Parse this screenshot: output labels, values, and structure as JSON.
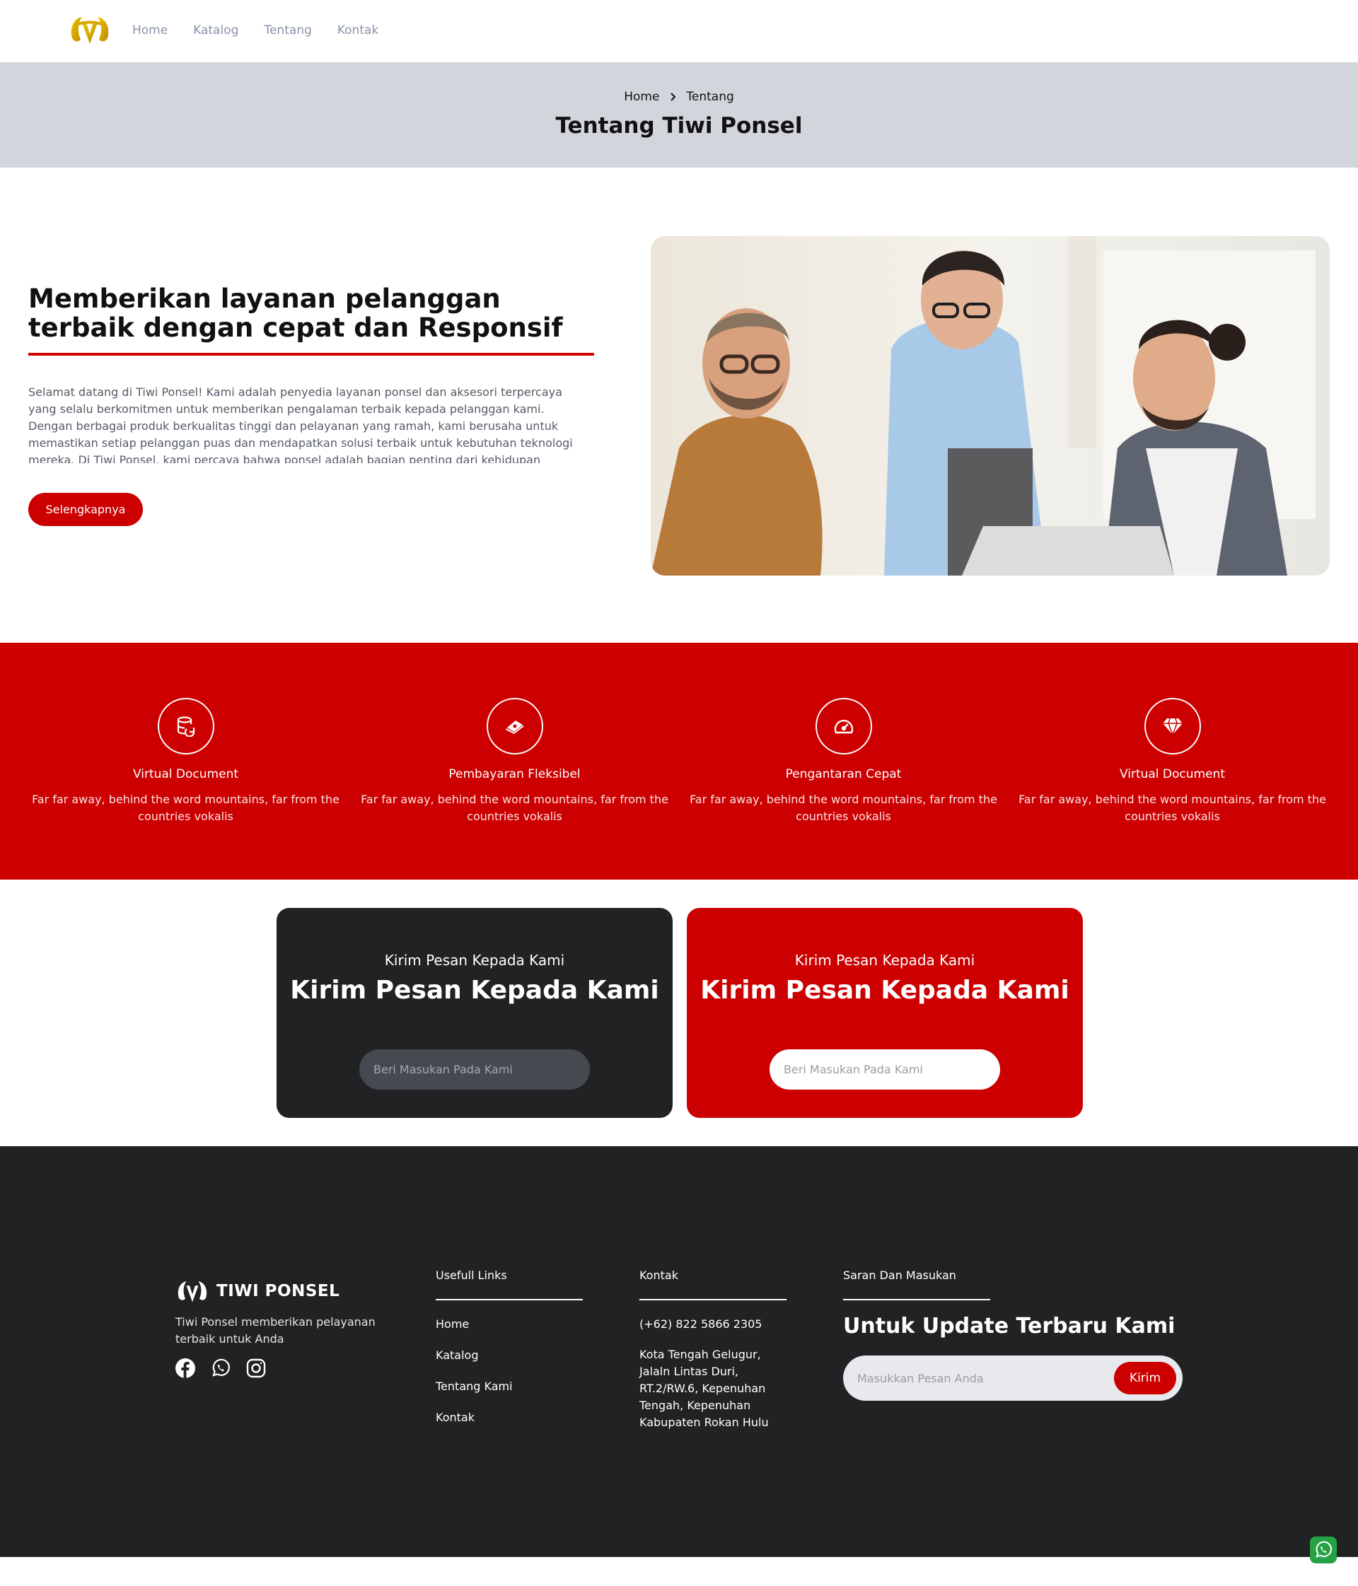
{
  "nav": {
    "logo_icon": "tiwi-ponsel-logo",
    "links": [
      "Home",
      "Katalog",
      "Tentang",
      "Kontak"
    ]
  },
  "hero": {
    "breadcrumb": [
      "Home",
      "Tentang"
    ],
    "title": "Tentang Tiwi Ponsel"
  },
  "about": {
    "heading": "Memberikan layanan pelanggan terbaik dengan cepat dan Responsif",
    "body": "Selamat datang di Tiwi Ponsel! Kami adalah penyedia layanan ponsel dan aksesori terpercaya yang selalu berkomitmen untuk memberikan pengalaman terbaik kepada pelanggan kami. Dengan berbagai produk berkualitas tinggi dan pelayanan yang ramah, kami berusaha untuk memastikan setiap pelanggan puas dan mendapatkan solusi terbaik untuk kebutuhan teknologi mereka. Di Tiwi Ponsel, kami percaya bahwa ponsel adalah bagian penting dari kehidupan sehari-",
    "button": "Selengkapnya"
  },
  "features": [
    {
      "icon": "database-icon",
      "title": "Virtual Document",
      "desc": "Far far away, behind the word mountains, far from the countries vokalis"
    },
    {
      "icon": "money-icon",
      "title": "Pembayaran Fleksibel",
      "desc": "Far far away, behind the word mountains, far from the countries vokalis"
    },
    {
      "icon": "speedometer-icon",
      "title": "Pengantaran Cepat",
      "desc": "Far far away, behind the word mountains, far from the countries vokalis"
    },
    {
      "icon": "diamond-icon",
      "title": "Virtual Document",
      "desc": "Far far away, behind the word mountains, far from the countries vokalis"
    }
  ],
  "message_cards": [
    {
      "subtitle": "Kirim Pesan Kepada Kami",
      "title": "Kirim Pesan Kepada Kami",
      "placeholder": "Beri Masukan Pada Kami"
    },
    {
      "subtitle": "Kirim Pesan Kepada Kami",
      "title": "Kirim Pesan Kepada Kami",
      "placeholder": "Beri Masukan Pada Kami"
    }
  ],
  "footer": {
    "brand": "TIWI PONSEL",
    "tagline": "Tiwi Ponsel memberikan pelayanan terbaik untuk Anda",
    "social_icons": [
      "facebook-icon",
      "whatsapp-icon",
      "instagram-icon"
    ],
    "links_title": "Usefull Links",
    "links": [
      "Home",
      "Katalog",
      "Tentang Kami",
      "Kontak"
    ],
    "contact_title": "Kontak",
    "phone": "(+62) 822 5866 2305",
    "address": "Kota Tengah Gelugur, Jalaln Lintas Duri, RT.2/RW.6, Kepenuhan Tengah, Kepenuhan Kabupaten Rokan Hulu",
    "feedback_title": "Saran Dan Masukan",
    "update_title": "Untuk Update Terbaru Kami",
    "subscribe_placeholder": "Masukkan Pesan Anda",
    "subscribe_button": "Kirim"
  },
  "floating": {
    "icon": "whatsapp-icon"
  },
  "colors": {
    "accent": "#cc0000",
    "dark": "#212223",
    "hero_bg": "#d3d5dc",
    "nav_text": "#8b92a8"
  }
}
